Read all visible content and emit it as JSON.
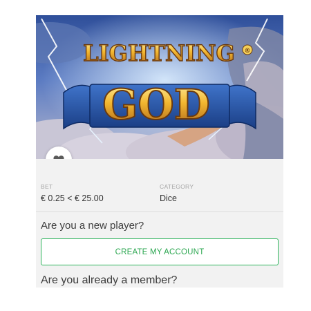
{
  "game": {
    "logo_line1": "LIGHTNING",
    "logo_line2": "GOD",
    "logo_mark": "®",
    "favorite_icon": "heart-icon"
  },
  "details": {
    "bet_label": "BET",
    "bet_value": "€ 0.25 < € 25.00",
    "category_label": "CATEGORY",
    "category_value": "Dice"
  },
  "signup": {
    "new_player_question": "Are you a new player?",
    "create_account_label": "CREATE MY ACCOUNT",
    "member_question": "Are you already a member?"
  },
  "colors": {
    "accent_green": "#2bb35a",
    "card_background": "#f2f2f2"
  }
}
